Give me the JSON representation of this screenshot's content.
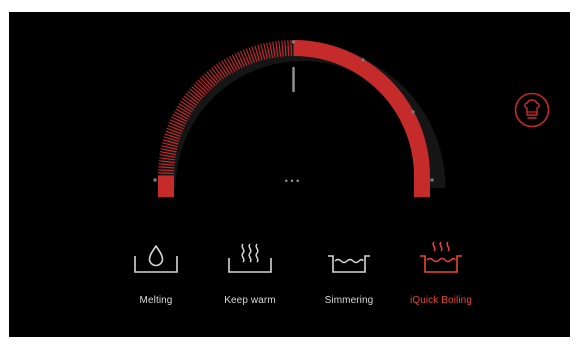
{
  "colors": {
    "background": "#000000",
    "accent": "#c62b2b",
    "accent_bright": "#e8453a",
    "inactive_text": "#d6d6d6",
    "track": "#161616",
    "indicator": "#8e8e8e"
  },
  "dial": {
    "level": 0.5,
    "center_indicator": "• • •"
  },
  "modes": [
    {
      "label": "Melting",
      "icon": "pot-droplet-icon",
      "active": false
    },
    {
      "label": "Keep warm",
      "icon": "steam-icon",
      "active": false
    },
    {
      "label": "Simmering",
      "icon": "pot-simmer-icon",
      "active": false
    },
    {
      "label": "iQuick Boiling",
      "icon": "pot-boiling-icon",
      "active": true
    }
  ],
  "chef_button": {
    "icon": "chef-hat-icon"
  }
}
